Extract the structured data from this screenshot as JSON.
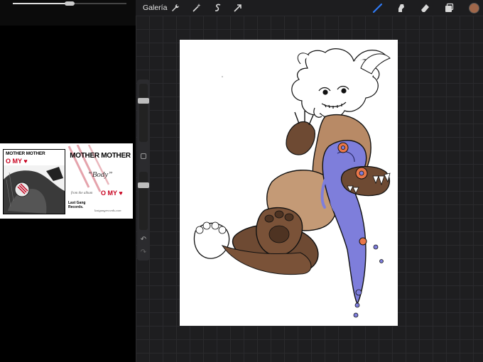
{
  "video": {
    "progress": 0.5
  },
  "album_card": {
    "cover_band_name": "MOTHER MOTHER",
    "cover_title": "O MY ♥",
    "band": "MOTHER MOTHER",
    "track": "“Body”",
    "from_text": "from the album",
    "album": "O MY ♥",
    "label": "Last Gang Records.",
    "url": "lastgangrecords.com"
  },
  "toolbar": {
    "gallery_label": "Galería",
    "current_color": "#a0674a"
  },
  "colors": {
    "fur_brown": "#b88a66",
    "dark_brown": "#6e4a33",
    "purple_goo": "#7e7edb",
    "eye_orange": "#e8774a",
    "accent_red": "#c8001e"
  }
}
